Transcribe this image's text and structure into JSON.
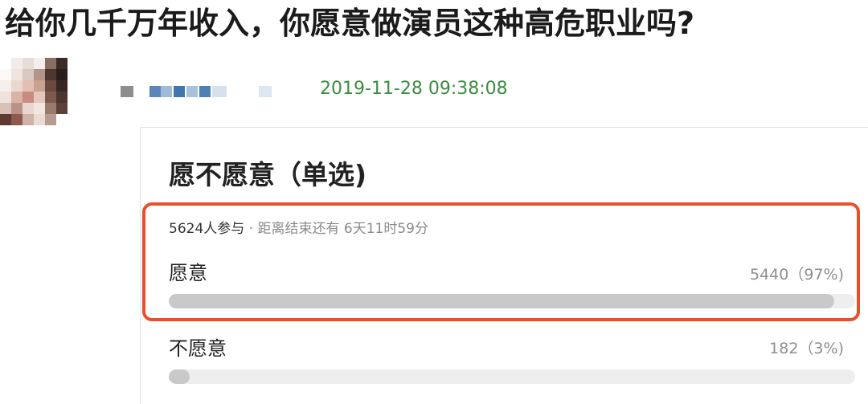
{
  "headline": "给你几千万年收入，你愿意做演员这种高危职业吗?",
  "post": {
    "timestamp": "2019-11-28 09:38:08"
  },
  "poll": {
    "title": "愿不愿意（单选)",
    "participants": "5624人参与",
    "separator": "·",
    "time_remaining": "距离结束还有 6天11时59分",
    "options": [
      {
        "label": "愿意",
        "count": "5440（97%)",
        "fraction": 0.97
      },
      {
        "label": "不愿意",
        "count": "182（3%)",
        "fraction": 0.03
      }
    ]
  },
  "colors": {
    "timestamp": "#3a8d3f",
    "highlight_border": "#e8502c",
    "bar_fill": "#c9c9c9",
    "bar_track": "#eeeeee"
  }
}
